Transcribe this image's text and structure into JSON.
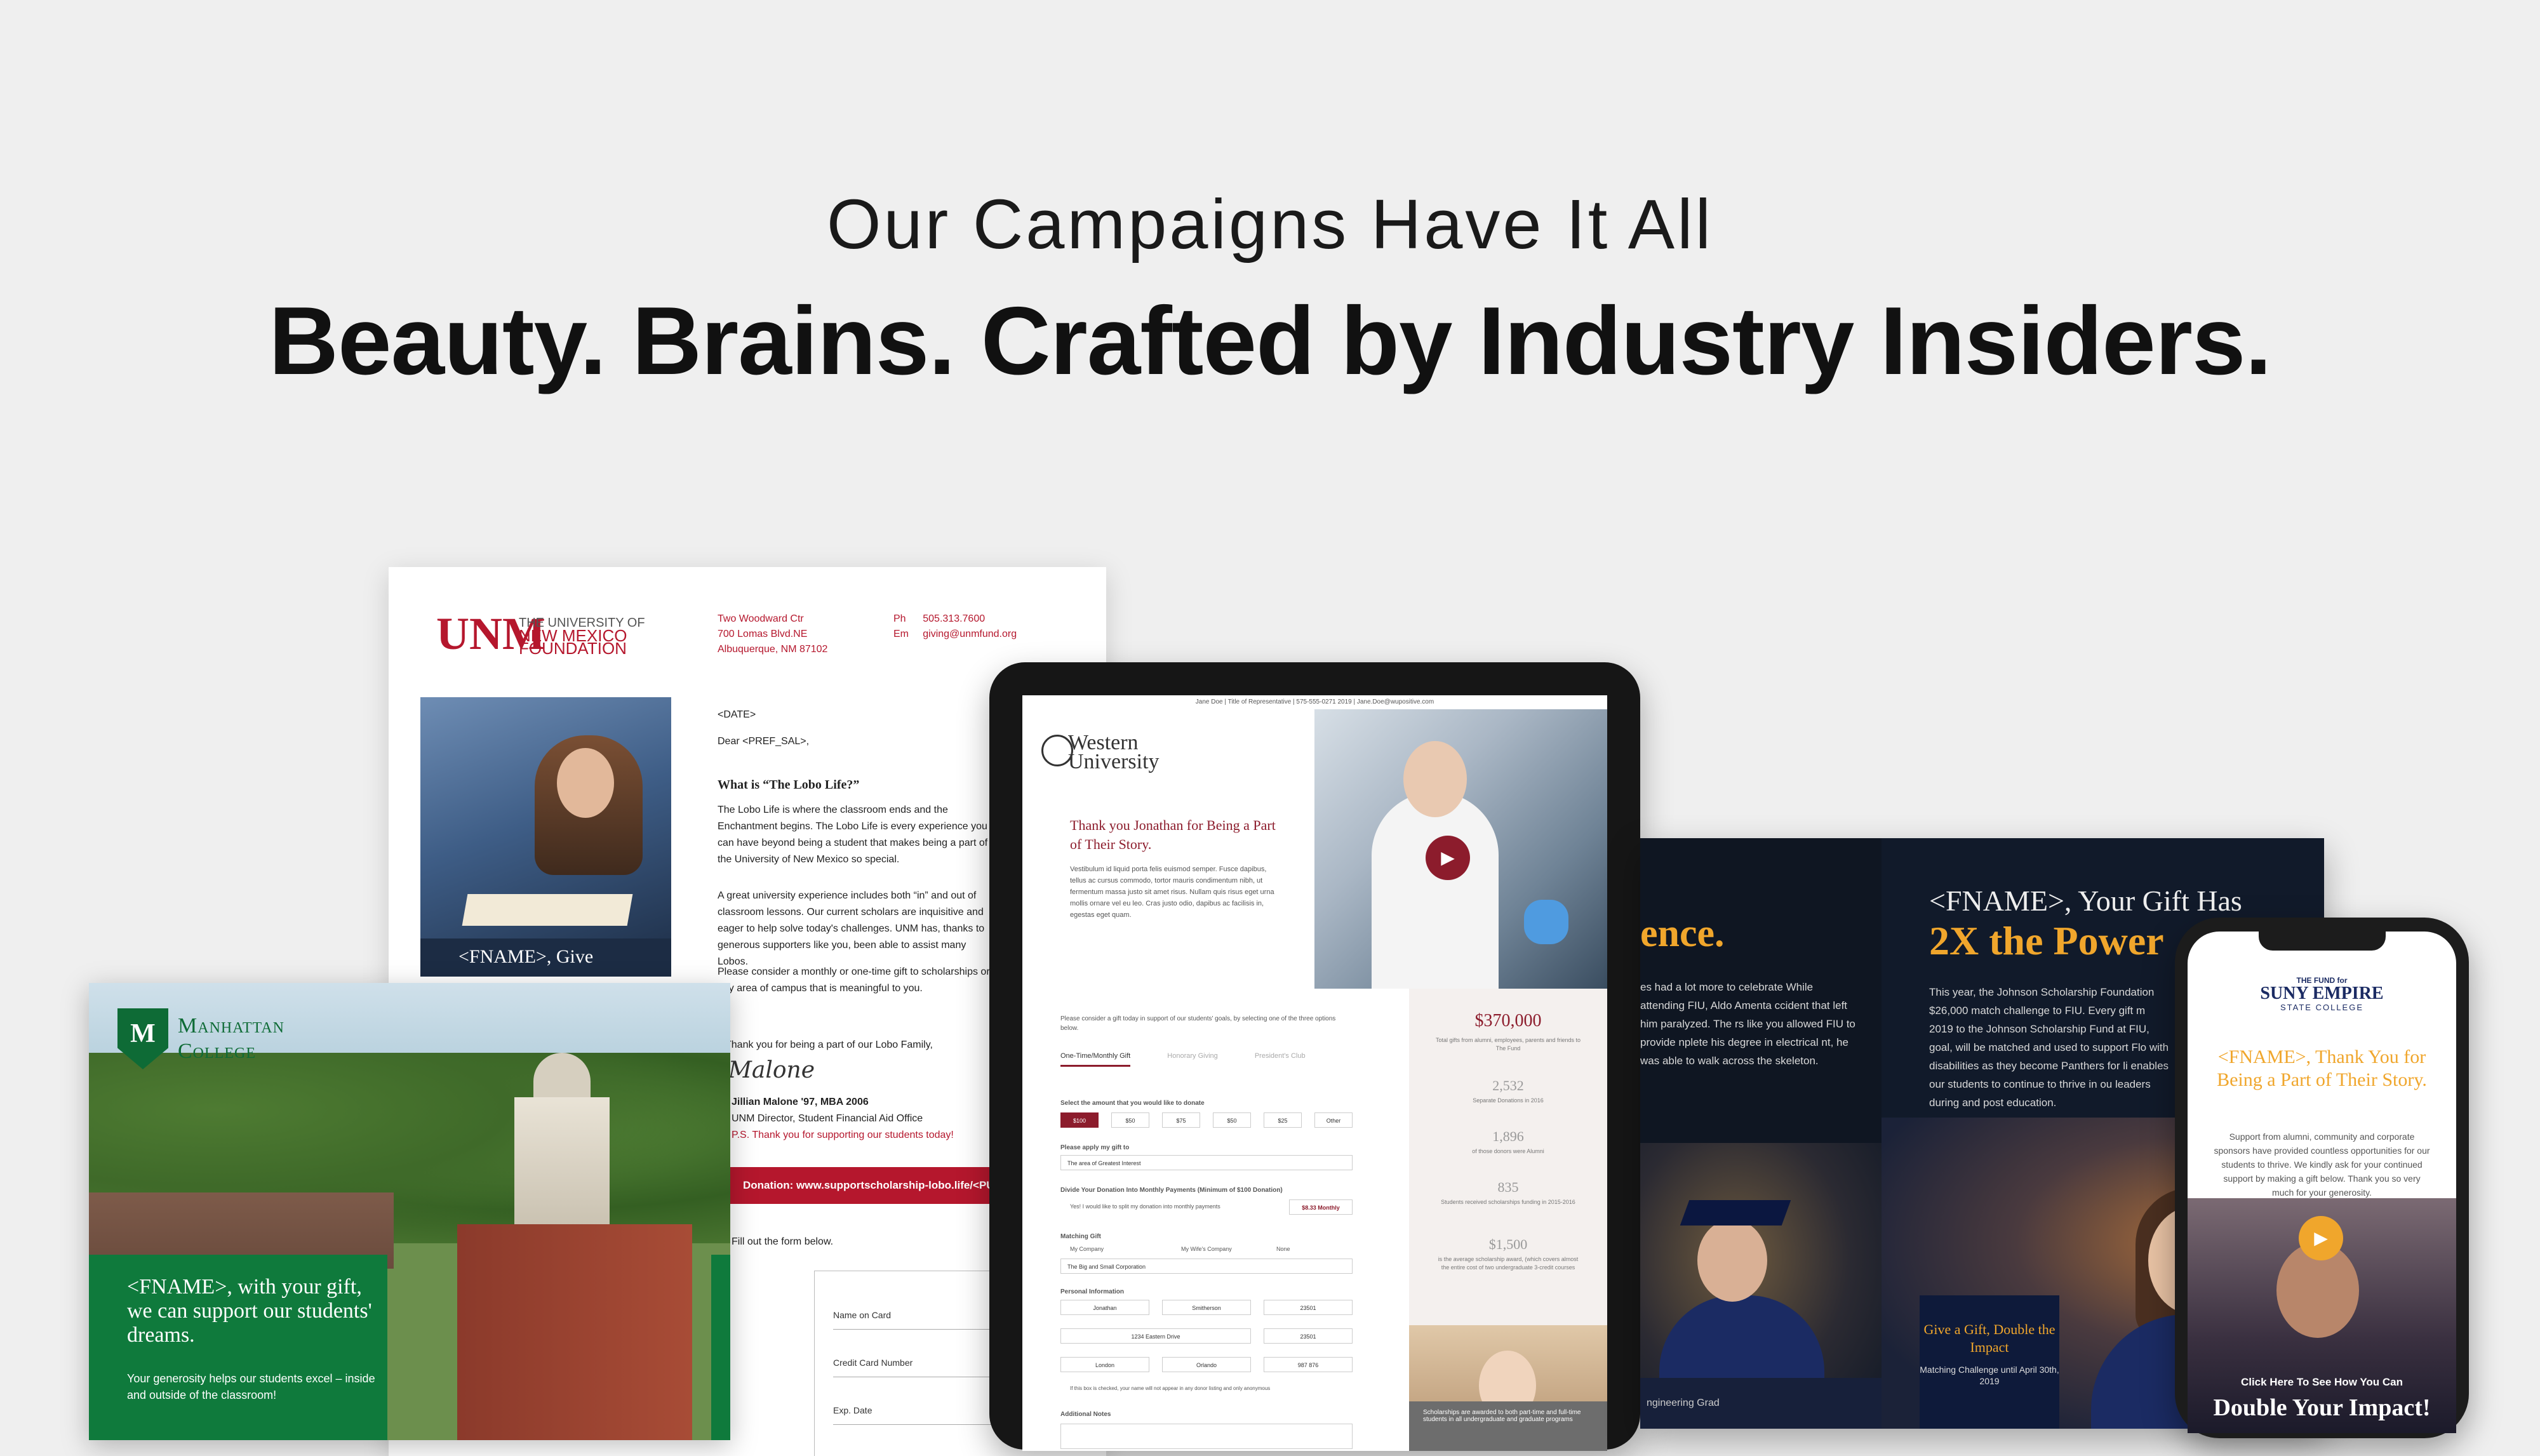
{
  "header": {
    "subtitle": "Our Campaigns Have It All",
    "headline": "Beauty. Brains. Crafted by Industry Insiders."
  },
  "letter": {
    "logo_mark": "UNM",
    "org_line1": "THE UNIVERSITY OF",
    "org_line2": "NEW MEXICO",
    "org_line3": "FOUNDATION",
    "address": [
      "Two Woodward Ctr",
      "700 Lomas Blvd.NE",
      "Albuquerque, NM  87102"
    ],
    "phone_label": "Ph",
    "phone": "505.313.7600",
    "email_label": "Em",
    "email": "giving@unmfund.org",
    "photo_caption": "<FNAME>, Give",
    "date": "<DATE>",
    "salutation": "Dear <PREF_SAL>,",
    "heading": "What is “The Lobo Life?”",
    "p1": "The Lobo Life is where the classroom ends and the Enchantment begins. The Lobo Life is every experience you can have beyond being a student that makes being a part of the University of New Mexico so special.",
    "p2": "A great university experience includes both “in” and out of classroom lessons. Our current scholars are inquisitive and eager to help solve today's challenges. UNM has, thanks to generous supporters like you, been able to assist many Lobos.",
    "p3": "Please consider a monthly or one-time gift to scholarships or any area of campus that is meaningful to you.",
    "thanks": "Thank you for being a part of our Lobo Family,",
    "signature": "Malone",
    "signer_name": "Jillian Malone '97, MBA 2006",
    "signer_title": "UNM Director, Student Financial Aid Office",
    "ps": "P.S. Thank you for supporting our students today!",
    "donation_bar": "Donation:  www.supportscholarship-lobo.life/<PURL>",
    "form_intro": "Fill out the form below.",
    "fields": [
      "Name on Card",
      "Credit Card Number",
      "Exp. Date"
    ]
  },
  "mailer": {
    "shield_letter": "M",
    "college_line1": "Manhattan",
    "college_line2": "College",
    "headline": "<FNAME>, with your gift, we can support our students' dreams.",
    "body": "Your generosity helps our students excel – inside and outside of the classroom!"
  },
  "tablet": {
    "topline": "Jane Doe  |  Title of Representative  |  575-555-0271 2019  |  Jane.Doe@wupositive.com",
    "logo": "Western University",
    "thank_you": "Thank you Jonathan for Being a Part of Their Story.",
    "body": "Vestibulum id liquid porta felis euismod semper. Fusce dapibus, tellus ac cursus commodo, tortor mauris condimentum nibh, ut fermentum massa justo sit amet risus. Nullam quis risus eget urna mollis ornare vel eu leo. Cras justo odio, dapibus ac facilisis in, egestas eget quam.",
    "form_intro": "Please consider a gift today in support of our students' goals, by selecting one of the three options below.",
    "tabs": [
      "One-Time/Monthly Gift",
      "Honorary Giving",
      "President's Club"
    ],
    "amount_label": "Select the amount that you would like to donate",
    "amounts": [
      "$100",
      "$50",
      "$75",
      "$50",
      "$25",
      "Other"
    ],
    "apply_label": "Please apply my gift to",
    "apply_value": "The area of Greatest Interest",
    "monthly_label": "Divide Your Donation Into Monthly Payments (Minimum of $100 Donation)",
    "monthly_check": "Yes! I would like to split my donation into monthly payments",
    "monthly_amount": "$8.33 Monthly",
    "matching_label": "Matching Gift",
    "matching_options": [
      "My Company",
      "My Wife's Company",
      "None"
    ],
    "company_value": "The Big and Small Corporation",
    "personal_label": "Personal Information",
    "first_name": "Jonathan",
    "last_name": "Smitherson",
    "zip1": "23501",
    "street": "1234 Eastern Drive",
    "unit": "23501",
    "city": "London",
    "state": "Orlando",
    "phone": "987 876",
    "anon_check": "If this box is checked, your name will not appear in any donor listing and only anonymous",
    "additional_label": "Additional Notes",
    "total_raised": "$370,000",
    "total_caption": "Total gifts from alumni, employees, parents and friends to The Fund",
    "stats": [
      {
        "value": "2,532",
        "caption": "Separate Donations in 2016"
      },
      {
        "value": "1,896",
        "caption": "of those donors were Alumni"
      },
      {
        "value": "835",
        "caption": "Students received scholarships funding in 2015-2016"
      },
      {
        "value": "$1,500",
        "caption": "is the average scholarship award, (which covers almost the entire cost of two undergraduate 3-credit courses"
      }
    ],
    "bottom_caption": "Scholarships are awarded to both part-time and full-time students in all undergraduate and graduate programs"
  },
  "brochure": {
    "left_heading": "ence.",
    "left_body": "es had a lot more to celebrate While attending FIU, Aldo Amenta ccident that left him paralyzed. The rs like you allowed FIU to provide nplete his degree in electrical nt, he was able to walk across the skeleton.",
    "left_footer": "ngineering Grad",
    "right_heading1": "<FNAME>, Your Gift Has",
    "right_heading2": "2X the Power",
    "right_body": "This year, the Johnson Scholarship Foundation $26,000 match challenge to FIU.  Every gift m 2019 to the Johnson Scholarship Fund at FIU, goal, will be matched and used to support Flo with disabilities as they become Panthers for li enables our students to continue to thrive in ou leaders during and post education.",
    "gift_title": "Give a Gift, Double the Impact",
    "gift_sub": "Matching Challenge until April 30th, 2019"
  },
  "phone": {
    "fund_line": "THE FUND for",
    "college1": "SUNY EMPIRE",
    "college2": "STATE COLLEGE",
    "thanks": "<FNAME>, Thank You for Being a Part of Their Story.",
    "body": "Support from alumni, community and corporate sponsors have provided countless opportunities for our students to thrive.  We kindly ask for your continued support by making a gift below. Thank you so very much for your generosity.",
    "cta_small": "Click Here To See How You Can",
    "cta_big": "Double Your Impact!"
  }
}
